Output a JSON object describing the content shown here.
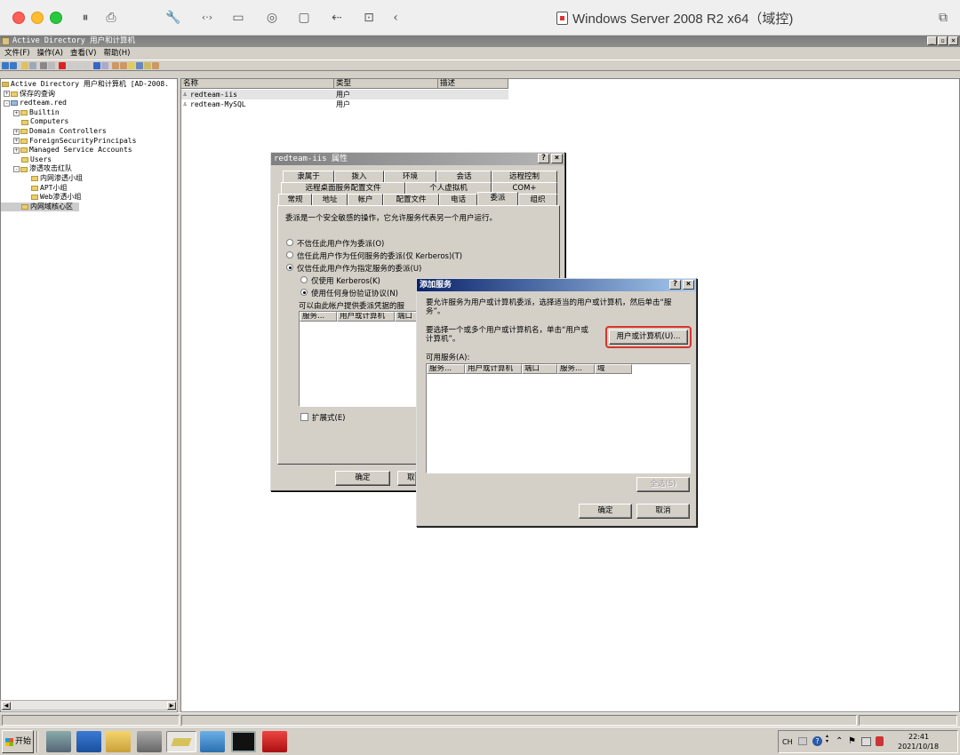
{
  "host": {
    "title": "Windows Server 2008 R2 x64（域控)",
    "toolbar_icons": [
      "pause-icon",
      "snapshot-icon",
      "wrench-icon",
      "code-icon",
      "drive-icon",
      "camera-icon",
      "video-icon",
      "usb-icon",
      "shared-folder-icon",
      "back-icon",
      "copy-icon"
    ]
  },
  "app": {
    "title": "Active Directory 用户和计算机",
    "menu": [
      "文件(F)",
      "操作(A)",
      "查看(V)",
      "帮助(H)"
    ]
  },
  "tree": {
    "items": [
      {
        "label": "Active Directory 用户和计算机 [AD-2008.",
        "expander": ""
      },
      {
        "label": "保存的查询",
        "expander": "+"
      },
      {
        "label": "redteam.red",
        "expander": "-"
      },
      {
        "label": "Builtin",
        "expander": "+"
      },
      {
        "label": "Computers",
        "expander": ""
      },
      {
        "label": "Domain Controllers",
        "expander": "+"
      },
      {
        "label": "ForeignSecurityPrincipals",
        "expander": "+"
      },
      {
        "label": "Managed Service Accounts",
        "expander": "+"
      },
      {
        "label": "Users",
        "expander": ""
      },
      {
        "label": "渗透攻击红队",
        "expander": "-"
      },
      {
        "label": "内网渗透小组",
        "expander": ""
      },
      {
        "label": "APT小组",
        "expander": ""
      },
      {
        "label": "Web渗透小组",
        "expander": ""
      },
      {
        "label": "内网域核心区",
        "expander": ""
      }
    ]
  },
  "list": {
    "headers": [
      "名称",
      "类型",
      "描述"
    ],
    "rows": [
      {
        "name": "redteam-iis",
        "type": "用户",
        "desc": ""
      },
      {
        "name": "redteam-MySQL",
        "type": "用户",
        "desc": ""
      }
    ]
  },
  "props": {
    "title": "redteam-iis 属性",
    "tabs_row1": [
      "隶属于",
      "拨入",
      "环境",
      "会话",
      "远程控制"
    ],
    "tabs_row2": [
      "远程桌面服务配置文件",
      "个人虚拟机",
      "COM+"
    ],
    "tabs_row3": [
      "常规",
      "地址",
      "帐户",
      "配置文件",
      "电话",
      "委派",
      "组织"
    ],
    "description": "委派是一个安全敏感的操作，它允许服务代表另一个用户运行。",
    "option1": "不信任此用户作为委派(O)",
    "option2": "信任此用户作为任何服务的委派(仅 Kerberos)(T)",
    "option3": "仅信任此用户作为指定服务的委派(U)",
    "sub1": "仅使用 Kerberos(K)",
    "sub2": "使用任何身份验证协议(N)",
    "list_label": "可以由此帐户提供委派凭据的服",
    "list_headers": [
      "服务...",
      "用户或计算机",
      "端口"
    ],
    "expand_label": "扩展式(E)",
    "ok": "确定",
    "cancel": "取"
  },
  "addsvc": {
    "title": "添加服务",
    "description": "要允许服务为用户或计算机委派，选择适当的用户或计算机，然后单击“服务”。",
    "hint": "要选择一个或多个用户或计算机名，单击“用户或计算机”。",
    "user_btn": "用户或计算机(U)...",
    "available_label": "可用服务(A):",
    "headers": [
      "服务...",
      "用户或计算机",
      "端口",
      "服务...",
      "域"
    ],
    "select_all": "全选(S)",
    "ok": "确定",
    "cancel": "取消"
  },
  "taskbar": {
    "start": "开始",
    "lang": "CH",
    "time": "22:41",
    "date": "2021/10/18"
  },
  "colors": {
    "highlight": "#d9342b",
    "active_title": "#0a246a"
  }
}
